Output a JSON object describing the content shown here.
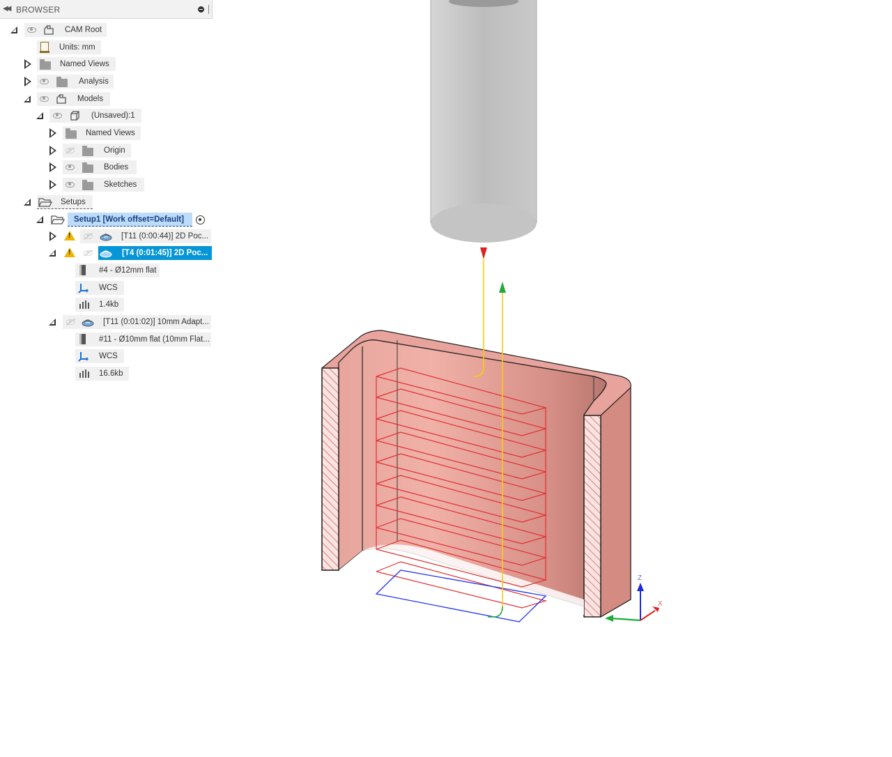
{
  "browser": {
    "title": "BROWSER"
  },
  "tree": {
    "cam_root": "CAM Root",
    "units": "Units: mm",
    "named_views": "Named Views",
    "analysis": "Analysis",
    "models": "Models",
    "unsaved": "(Unsaved):1",
    "model_named_views": "Named Views",
    "origin": "Origin",
    "bodies": "Bodies",
    "sketches": "Sketches",
    "setups": "Setups",
    "setup1": "Setup1 [Work offset=Default]",
    "op1": "[T11 (0:00:44)] 2D Poc...",
    "op2": "[T4 (0:01:45)] 2D Poc...",
    "op2_tool": "#4 - Ø12mm flat",
    "op2_wcs": "WCS",
    "op2_nc": "1.4kb",
    "op3": "[T11 (0:01:02)] 10mm Adapt...",
    "op3_tool": "#11 - Ø10mm flat (10mm Flat...",
    "op3_wcs": "WCS",
    "op3_nc": "16.6kb"
  },
  "viewcube": {
    "z_label": "Z",
    "x_label": "X"
  },
  "colors": {
    "part_face": "#e8a49c",
    "part_dark": "#c47a72",
    "toolpath_cut": "#e03030",
    "toolpath_lead": "#ffcc00",
    "toolpath_link": "#1faa3a",
    "toolpath_plunge": "#2244ff",
    "tool_body": "#c8c8c8",
    "selection": "#0696d7"
  }
}
